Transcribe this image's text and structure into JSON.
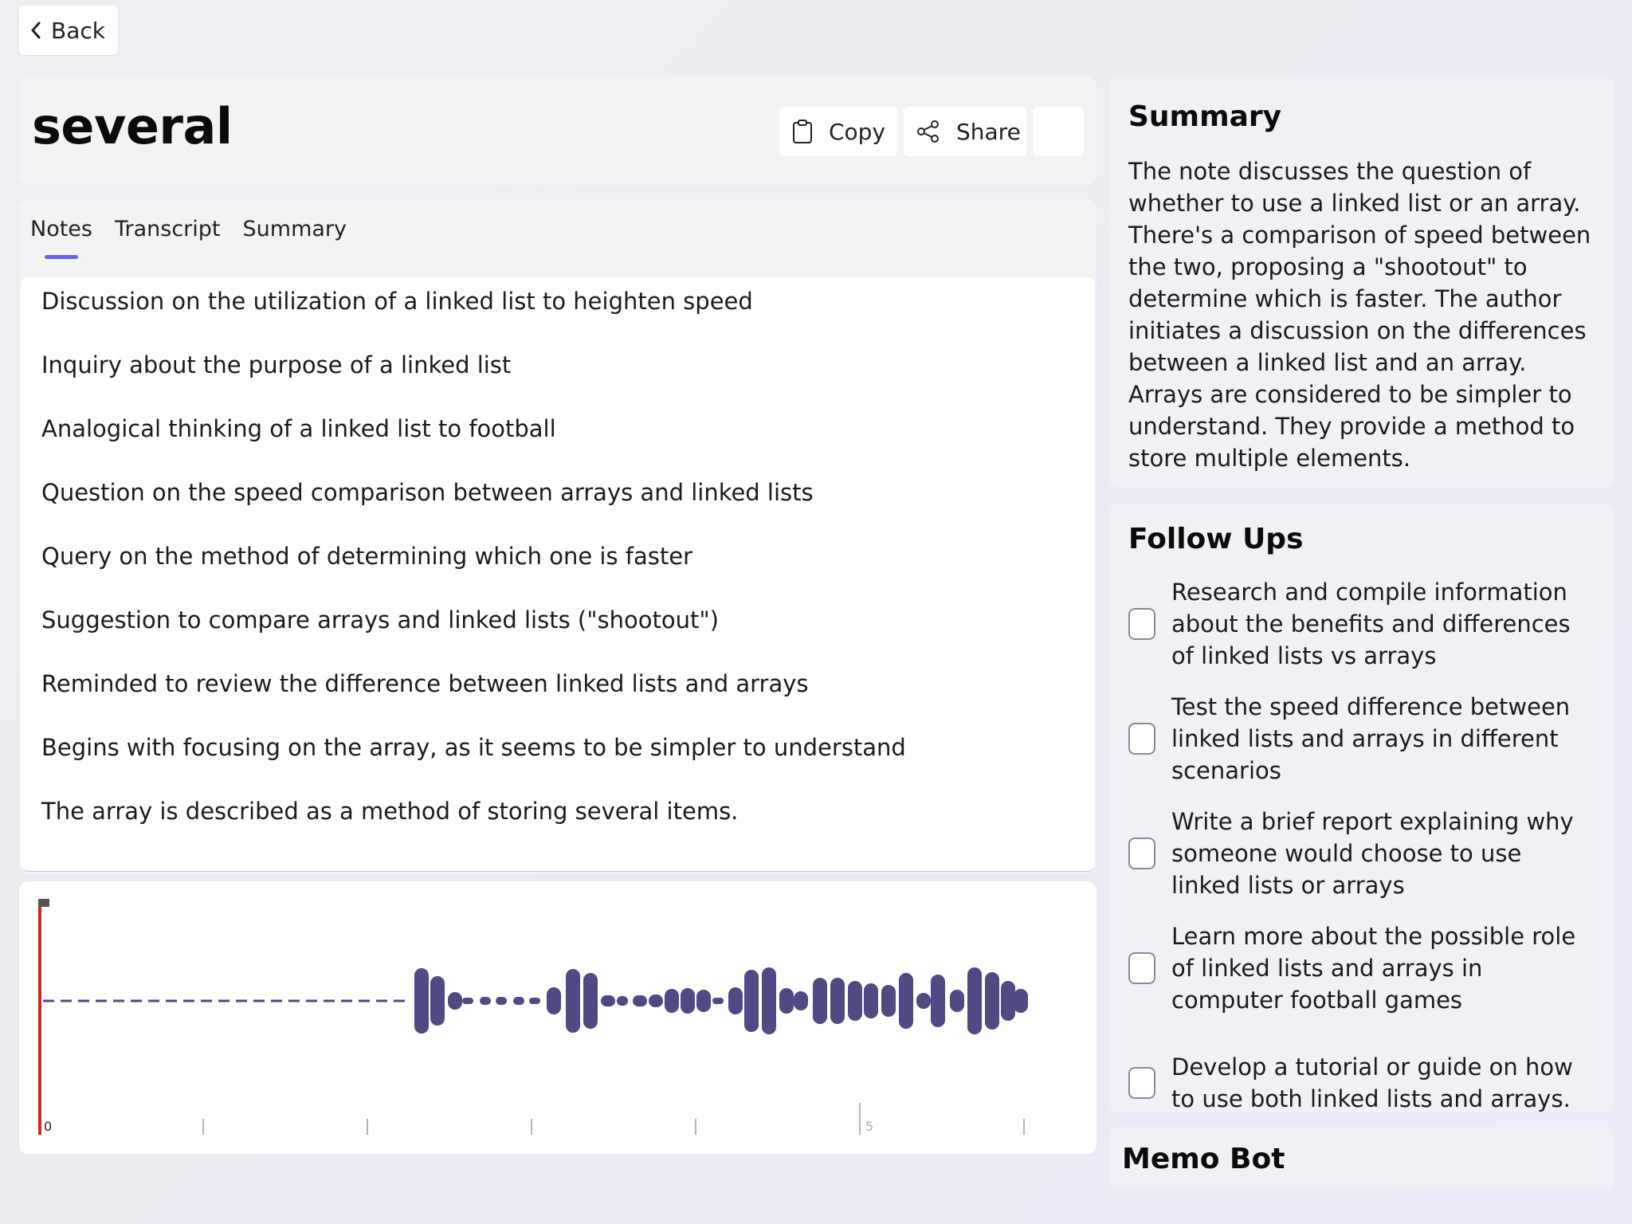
{
  "nav": {
    "back_label": "Back"
  },
  "note": {
    "title": "several",
    "actions": {
      "copy_label": "Copy",
      "share_label": "Share"
    },
    "tabs": [
      {
        "label": "Notes",
        "active": true
      },
      {
        "label": "Transcript",
        "active": false
      },
      {
        "label": "Summary",
        "active": false
      }
    ],
    "items": [
      "Discussion on the utilization of a linked list to heighten speed",
      "Inquiry about the purpose of a linked list",
      "Analogical thinking of a linked list to football",
      "Question on the speed comparison between arrays and linked lists",
      "Query on the method of determining which one is faster",
      "Suggestion to compare arrays and linked lists (\"shootout\")",
      "Reminded to review the difference between linked lists and arrays",
      "Begins with focusing on the array, as it seems to be simpler to understand",
      "The array is described as a method of storing several items."
    ]
  },
  "waveform": {
    "playhead_time": 0,
    "tick_labels": [
      "0",
      "5"
    ],
    "bar_color": "#4f4a84",
    "playhead_color": "#e02020"
  },
  "summary": {
    "heading": "Summary",
    "text": "The note discusses the question of whether to use a linked list or an array. There's a comparison of speed between the two, proposing a \"shootout\" to determine which is faster. The author initiates a discussion on the differences between a linked list and an array. Arrays are considered to be simpler to understand. They provide a method to store multiple elements."
  },
  "follow_ups": {
    "heading": "Follow Ups",
    "items": [
      {
        "text": "Research and compile information about the benefits and differences of linked lists vs arrays",
        "checked": false
      },
      {
        "text": "Test the speed difference between linked lists and arrays in different scenarios",
        "checked": false
      },
      {
        "text": "Write a brief report explaining why someone would choose to use linked lists or arrays",
        "checked": false
      },
      {
        "text": "Learn more about the possible role of linked lists and arrays in computer football games",
        "checked": false
      },
      {
        "text": "Develop a tutorial or guide on how to use both linked lists and arrays.",
        "checked": false
      }
    ]
  },
  "memo_bot": {
    "heading": "Memo Bot"
  },
  "colors": {
    "accent": "#6a63e6"
  }
}
